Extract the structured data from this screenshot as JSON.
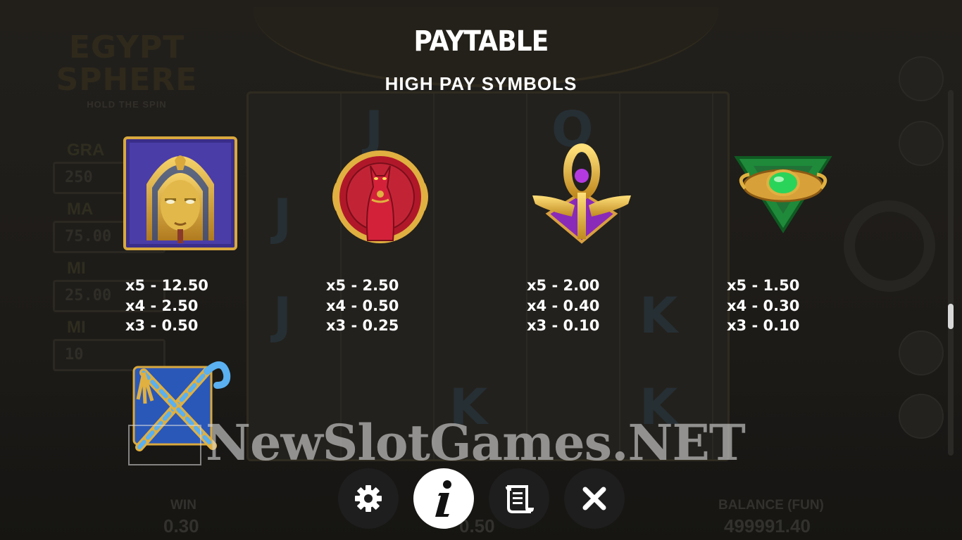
{
  "paytable": {
    "title": "PAYTABLE",
    "section_title": "HIGH PAY SYMBOLS",
    "symbols": [
      {
        "icon": "pharaoh-mask-icon",
        "payouts": [
          "x5 - 12.50",
          "x4 - 2.50",
          "x3 - 0.50"
        ]
      },
      {
        "icon": "red-cat-icon",
        "payouts": [
          "x5 - 2.50",
          "x4 - 0.50",
          "x3 - 0.25"
        ]
      },
      {
        "icon": "golden-ankh-icon",
        "payouts": [
          "x5 - 2.00",
          "x4 - 0.40",
          "x3 - 0.10"
        ]
      },
      {
        "icon": "green-scarab-amulet-icon",
        "payouts": [
          "x5 - 1.50",
          "x4 - 0.30",
          "x3 - 0.10"
        ]
      },
      {
        "icon": "crook-and-flail-icon",
        "payouts": []
      }
    ]
  },
  "background_game": {
    "logo_line1": "EGYPT",
    "logo_line2": "SPHERE",
    "logo_line3": "HOLD THE SPIN",
    "jackpots": [
      {
        "label": "GRA",
        "value": "250"
      },
      {
        "label": "MA",
        "value": "75.00"
      },
      {
        "label": "MI",
        "value": "25.00"
      },
      {
        "label": "MI",
        "value": "10"
      }
    ],
    "win_label": "WIN",
    "win_value": "0.30",
    "bet_value": "0.50",
    "balance_label": "BALANCE (FUN)",
    "balance_value": "499991.40"
  },
  "watermark": "NewSlotGames.NET",
  "menu": {
    "buttons": [
      {
        "name": "settings",
        "icon": "gear-icon"
      },
      {
        "name": "info",
        "icon": "info-icon",
        "active": true
      },
      {
        "name": "rules",
        "icon": "scroll-icon"
      },
      {
        "name": "close",
        "icon": "close-icon"
      }
    ]
  }
}
